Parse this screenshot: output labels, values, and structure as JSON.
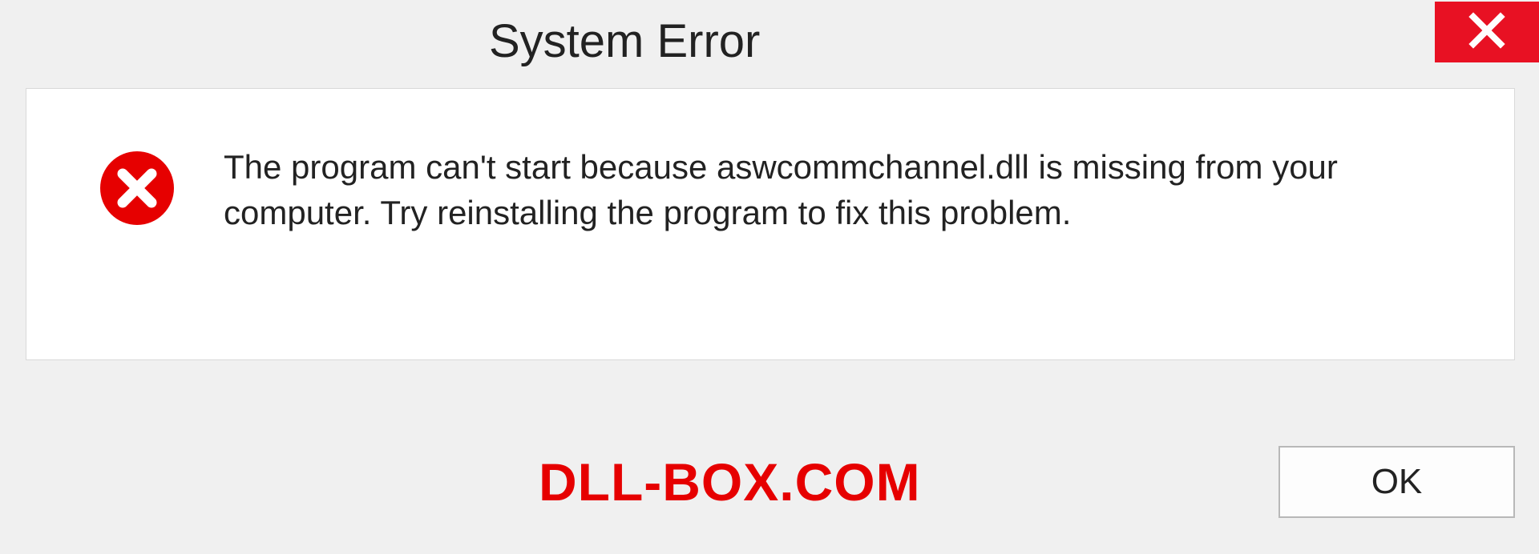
{
  "dialog": {
    "title": "System Error",
    "message": "The program can't start because aswcommchannel.dll is missing from your computer. Try reinstalling the program to fix this problem.",
    "ok_label": "OK"
  },
  "watermark": "DLL-BOX.COM",
  "colors": {
    "close_bg": "#e81123",
    "error_red": "#e60000"
  }
}
